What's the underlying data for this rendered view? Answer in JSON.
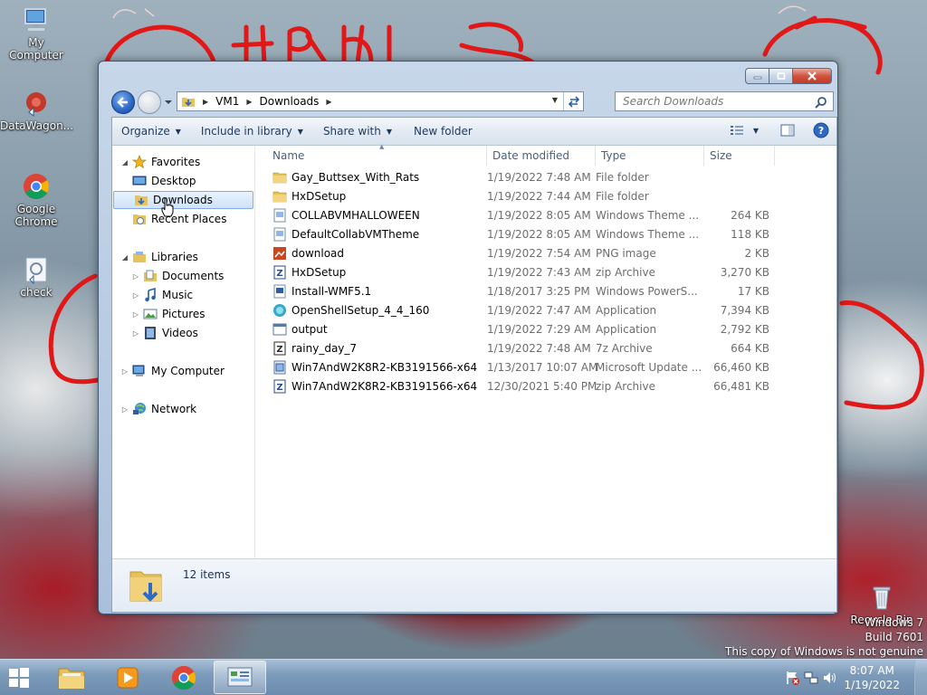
{
  "desktop": {
    "icons": [
      {
        "label": "My Computer",
        "icon": "computer-icon"
      },
      {
        "label": "DataWagon...",
        "icon": "datawagon-icon"
      },
      {
        "label": "Google Chrome",
        "icon": "chrome-icon"
      },
      {
        "label": "check",
        "icon": "check-icon"
      },
      {
        "label": "Recycle Bin",
        "icon": "recycle-bin-icon"
      }
    ],
    "watermark": {
      "line1": "Windows 7",
      "line2": "Build 7601",
      "line3": "This copy of Windows is not genuine"
    }
  },
  "window": {
    "address": {
      "crumbs": [
        "VM1",
        "Downloads"
      ]
    },
    "search": {
      "placeholder": "Search Downloads"
    },
    "toolbar": {
      "organize": "Organize",
      "include_in_library": "Include in library",
      "share_with": "Share with",
      "new_folder": "New folder"
    },
    "nav": {
      "favorites": "Favorites",
      "desktop": "Desktop",
      "downloads": "Downloads",
      "recent_places": "Recent Places",
      "libraries": "Libraries",
      "documents": "Documents",
      "music": "Music",
      "pictures": "Pictures",
      "videos": "Videos",
      "my_computer": "My Computer",
      "network": "Network"
    },
    "columns": {
      "name": "Name",
      "date": "Date modified",
      "type": "Type",
      "size": "Size"
    },
    "files": [
      {
        "name": "Gay_Buttsex_With_Rats",
        "date": "1/19/2022 7:48 AM",
        "type": "File folder",
        "size": "",
        "icon": "folder-icon"
      },
      {
        "name": "HxDSetup",
        "date": "1/19/2022 7:44 AM",
        "type": "File folder",
        "size": "",
        "icon": "folder-icon"
      },
      {
        "name": "COLLABVMHALLOWEEN",
        "date": "1/19/2022 8:05 AM",
        "type": "Windows Theme ...",
        "size": "264 KB",
        "icon": "theme-file-icon"
      },
      {
        "name": "DefaultCollabVMTheme",
        "date": "1/19/2022 8:05 AM",
        "type": "Windows Theme ...",
        "size": "118 KB",
        "icon": "theme-file-icon"
      },
      {
        "name": "download",
        "date": "1/19/2022 7:54 AM",
        "type": "PNG image",
        "size": "2 KB",
        "icon": "png-image-icon"
      },
      {
        "name": "HxDSetup",
        "date": "1/19/2022 7:43 AM",
        "type": "zip Archive",
        "size": "3,270 KB",
        "icon": "zip-archive-icon"
      },
      {
        "name": "Install-WMF5.1",
        "date": "1/18/2017 3:25 PM",
        "type": "Windows PowerS...",
        "size": "17 KB",
        "icon": "powershell-script-icon"
      },
      {
        "name": "OpenShellSetup_4_4_160",
        "date": "1/19/2022 7:47 AM",
        "type": "Application",
        "size": "7,394 KB",
        "icon": "openshell-app-icon"
      },
      {
        "name": "output",
        "date": "1/19/2022 7:29 AM",
        "type": "Application",
        "size": "2,792 KB",
        "icon": "application-icon"
      },
      {
        "name": "rainy_day_7",
        "date": "1/19/2022 7:48 AM",
        "type": "7z Archive",
        "size": "664 KB",
        "icon": "7z-archive-icon"
      },
      {
        "name": "Win7AndW2K8R2-KB3191566-x64",
        "date": "1/13/2017 10:07 AM",
        "type": "Microsoft Update ...",
        "size": "66,460 KB",
        "icon": "msu-update-icon"
      },
      {
        "name": "Win7AndW2K8R2-KB3191566-x64",
        "date": "12/30/2021 5:40 PM",
        "type": "zip Archive",
        "size": "66,481 KB",
        "icon": "zip-archive-icon"
      }
    ],
    "details": {
      "count": "12 items"
    }
  },
  "taskbar": {
    "clock_time": "8:07 AM",
    "clock_date": "1/19/2022"
  },
  "colors": {
    "accent": "#1e395b",
    "selection": "#cfe3fb",
    "scribble": "#e01818"
  }
}
